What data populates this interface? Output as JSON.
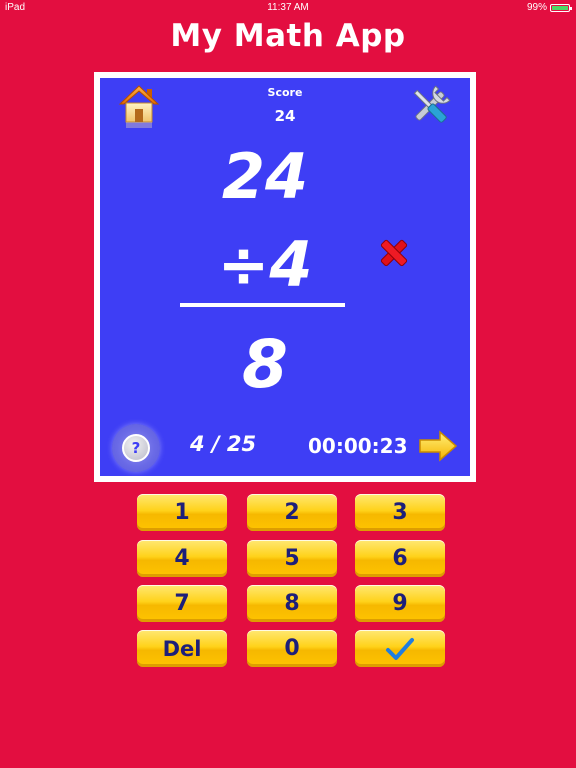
{
  "status_bar": {
    "device": "iPad",
    "time": "11:37 AM",
    "battery": "99%",
    "battery_level": 0.99,
    "battery_color": "#4cd964"
  },
  "app": {
    "title": "My Math App",
    "background_color": "#e30e40",
    "board_color": "#3e3ef5"
  },
  "header": {
    "home_icon": "home-icon",
    "settings_icon": "tools-icon",
    "score_label": "Score",
    "score_value": "24"
  },
  "problem": {
    "operand_top": "24",
    "operand_bottom": "÷4",
    "answer": "8",
    "status_icon": "red-x-icon"
  },
  "footer": {
    "help_icon": "question-icon",
    "help_label": "?",
    "progress": "4 / 25",
    "timer": "00:00:23",
    "next_icon": "arrow-right-icon"
  },
  "keypad": {
    "keys": [
      "1",
      "2",
      "3",
      "4",
      "5",
      "6",
      "7",
      "8",
      "9",
      "Del",
      "0"
    ],
    "submit_icon": "checkmark-icon",
    "key_color": "#ffd21a",
    "label_color": "#1d1f7a"
  }
}
